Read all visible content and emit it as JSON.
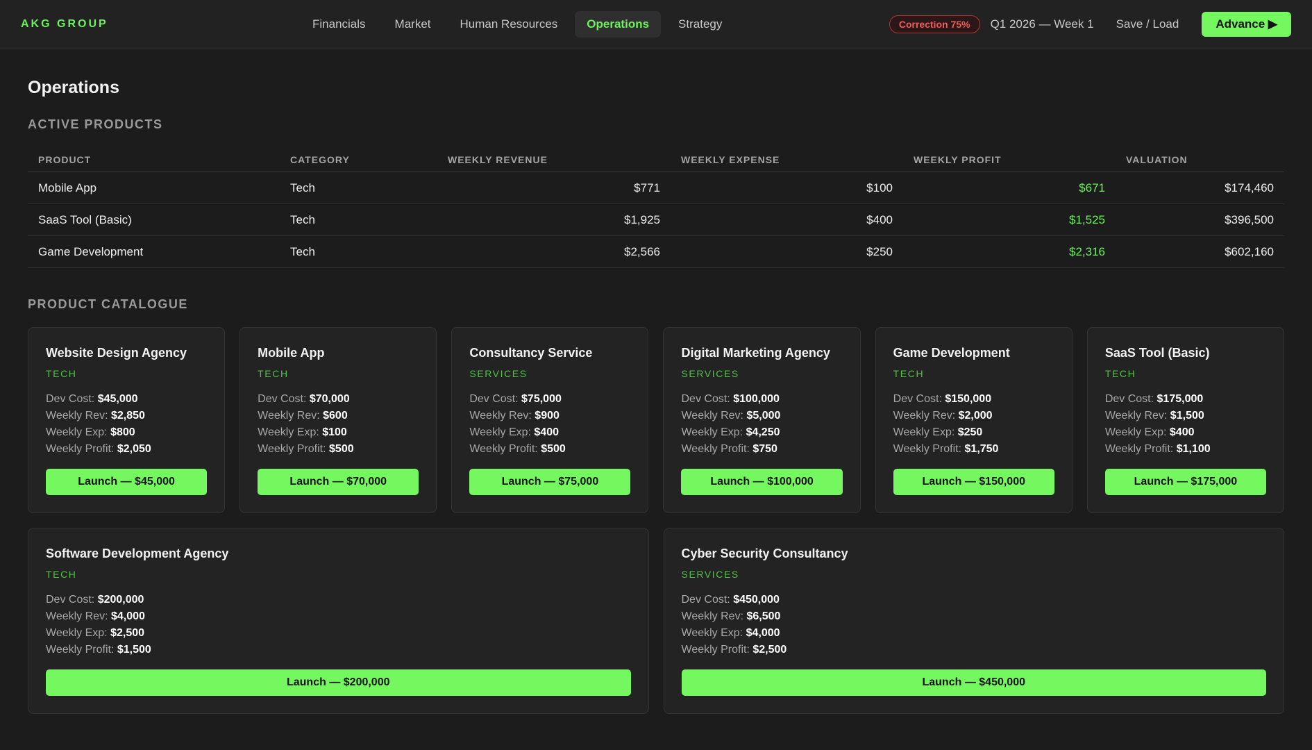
{
  "header": {
    "brand": "AKG GROUP",
    "nav": [
      "Financials",
      "Market",
      "Human Resources",
      "Operations",
      "Strategy"
    ],
    "active_nav": "Operations",
    "correction_badge": "Correction 75%",
    "week": "Q1 2026 — Week 1",
    "save_load": "Save / Load",
    "advance": "Advance ▶"
  },
  "page_title": "Operations",
  "active_products": {
    "title": "ACTIVE PRODUCTS",
    "columns": [
      "PRODUCT",
      "CATEGORY",
      "WEEKLY REVENUE",
      "WEEKLY EXPENSE",
      "WEEKLY PROFIT",
      "VALUATION"
    ],
    "rows": [
      {
        "product": "Mobile App",
        "category": "Tech",
        "revenue": "$771",
        "expense": "$100",
        "profit": "$671",
        "valuation": "$174,460"
      },
      {
        "product": "SaaS Tool (Basic)",
        "category": "Tech",
        "revenue": "$1,925",
        "expense": "$400",
        "profit": "$1,525",
        "valuation": "$396,500"
      },
      {
        "product": "Game Development",
        "category": "Tech",
        "revenue": "$2,566",
        "expense": "$250",
        "profit": "$2,316",
        "valuation": "$602,160"
      }
    ]
  },
  "catalogue": {
    "title": "PRODUCT CATALOGUE",
    "labels": {
      "dev_cost": "Dev Cost:",
      "weekly_rev": "Weekly Rev:",
      "weekly_exp": "Weekly Exp:",
      "weekly_profit": "Weekly Profit:"
    },
    "items": [
      {
        "name": "Website Design Agency",
        "category": "TECH",
        "dev_cost": "$45,000",
        "rev": "$2,850",
        "exp": "$800",
        "profit": "$2,050",
        "launch": "Launch — $45,000"
      },
      {
        "name": "Mobile App",
        "category": "TECH",
        "dev_cost": "$70,000",
        "rev": "$600",
        "exp": "$100",
        "profit": "$500",
        "launch": "Launch — $70,000"
      },
      {
        "name": "Consultancy Service",
        "category": "SERVICES",
        "dev_cost": "$75,000",
        "rev": "$900",
        "exp": "$400",
        "profit": "$500",
        "launch": "Launch — $75,000"
      },
      {
        "name": "Digital Marketing Agency",
        "category": "SERVICES",
        "dev_cost": "$100,000",
        "rev": "$5,000",
        "exp": "$4,250",
        "profit": "$750",
        "launch": "Launch — $100,000"
      },
      {
        "name": "Game Development",
        "category": "TECH",
        "dev_cost": "$150,000",
        "rev": "$2,000",
        "exp": "$250",
        "profit": "$1,750",
        "launch": "Launch — $150,000"
      },
      {
        "name": "SaaS Tool (Basic)",
        "category": "TECH",
        "dev_cost": "$175,000",
        "rev": "$1,500",
        "exp": "$400",
        "profit": "$1,100",
        "launch": "Launch — $175,000"
      },
      {
        "name": "Software Development Agency",
        "category": "TECH",
        "dev_cost": "$200,000",
        "rev": "$4,000",
        "exp": "$2,500",
        "profit": "$1,500",
        "launch": "Launch — $200,000"
      },
      {
        "name": "Cyber Security Consultancy",
        "category": "SERVICES",
        "dev_cost": "$450,000",
        "rev": "$6,500",
        "exp": "$4,000",
        "profit": "$2,500",
        "launch": "Launch — $450,000"
      }
    ]
  },
  "colors": {
    "accent": "#75f75f",
    "background": "#1c1c1c",
    "card": "#232323",
    "danger": "#f05a5a"
  }
}
